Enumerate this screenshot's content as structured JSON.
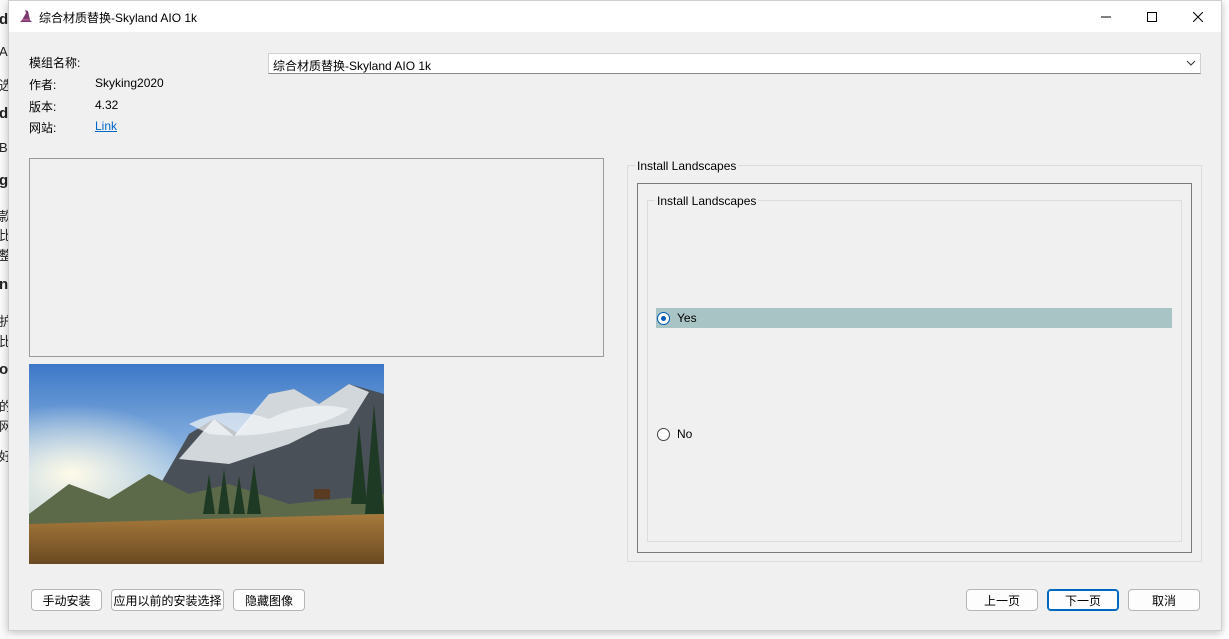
{
  "background_window": {
    "lines": [
      "d",
      "A",
      "选",
      "d",
      "B",
      "g",
      "款",
      "比",
      "整",
      "n",
      "护",
      "比",
      "o'",
      "的",
      "网",
      "好"
    ]
  },
  "window": {
    "title": "综合材质替换-Skyland AIO 1k",
    "controls": [
      "minimize-icon",
      "maximize-icon",
      "close-icon"
    ]
  },
  "mod_info": {
    "name_label": "模组名称:",
    "author_label": "作者:",
    "author": "Skyking2020",
    "version_label": "版本:",
    "version": "4.32",
    "website_label": "网站:",
    "website_link": "Link"
  },
  "mod_select": {
    "selected": "综合材质替换-Skyland AIO 1k"
  },
  "options": {
    "outer_group_title": "Install Landscapes",
    "inner_group_title": "Install Landscapes",
    "choices": [
      {
        "label": "Yes",
        "selected": true
      },
      {
        "label": "No",
        "selected": false
      }
    ],
    "selection_color": "#a9c4c4"
  },
  "buttons": {
    "manual_install": "手动安装",
    "apply_previous": "应用以前的安装选择",
    "hide_image": "隐藏图像",
    "prev": "上一页",
    "next": "下一页",
    "cancel": "取消"
  },
  "colors": {
    "window_bg": "#f0f0f0",
    "accent": "#0067c0",
    "link": "#0066cc"
  }
}
